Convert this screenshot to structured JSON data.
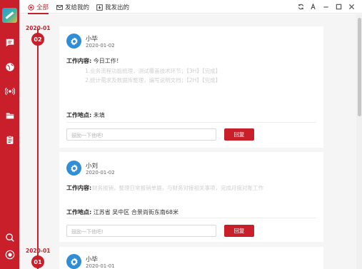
{
  "tabs": [
    {
      "label": "全部",
      "icon": "circle-dot-icon",
      "active": true
    },
    {
      "label": "发给我的",
      "icon": "envelope-icon",
      "active": false
    },
    {
      "label": "我发出的",
      "icon": "outbox-icon",
      "active": false
    }
  ],
  "colors": {
    "accent": "#c91f2b",
    "avatar": "#2f8ed6"
  },
  "timeline": [
    {
      "date": "2020-01",
      "day": "02"
    },
    {
      "date": "2020-01",
      "day": "01"
    }
  ],
  "cards": [
    {
      "user": "小毕",
      "date": "2020-01-02",
      "content_label": "工作内容:",
      "content_text": "今日工作！",
      "faded_lines": [
        "1.业务流程功能梳理，测试覆盖技术环节；【3H】【完成】",
        "2.统计需求及数据库整理，编写说明文档；【2H】【完成】"
      ],
      "location_label": "工作地点:",
      "location": "未填",
      "comment_placeholder": "鼓励一下他吧!",
      "reply_label": "回复"
    },
    {
      "user": "小刘",
      "date": "2020-01-02",
      "content_label": "工作内容:",
      "faded_text": "财务报销，整理日常报销单据，与财务对接相关事项，完成月度对账工作",
      "location_label": "工作地点:",
      "location": "江苏省 吴中区 合景尚街东南68米",
      "comment_placeholder": "鼓励一下他吧!",
      "reply_label": "回复"
    },
    {
      "user": "小毕",
      "date": "2020-01-01"
    }
  ]
}
